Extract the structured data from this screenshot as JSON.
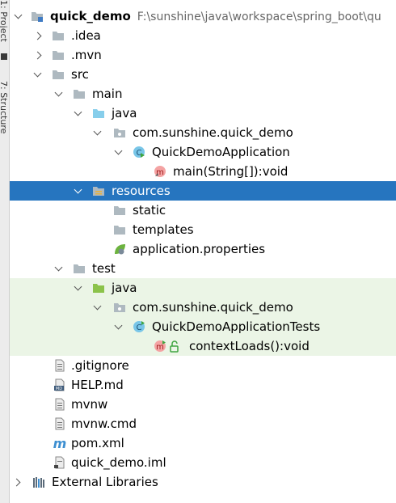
{
  "side_panel": {
    "project_tab": "1: Project",
    "structure_tab": "7: Structure"
  },
  "tree": {
    "root": {
      "name": "quick_demo",
      "path": "F:\\sunshine\\java\\workspace\\spring_boot\\qu"
    },
    "idea": ".idea",
    "mvn": ".mvn",
    "src": "src",
    "main": "main",
    "main_java": "java",
    "main_pkg": "com.sunshine.quick_demo",
    "app_class": "QuickDemoApplication",
    "main_method": "main(String[]):void",
    "resources": "resources",
    "static": "static",
    "templates": "templates",
    "app_props": "application.properties",
    "test": "test",
    "test_java": "java",
    "test_pkg": "com.sunshine.quick_demo",
    "test_class": "QuickDemoApplicationTests",
    "test_method": "contextLoads():void",
    "gitignore": ".gitignore",
    "help": "HELP.md",
    "mvnw": "mvnw",
    "mvnw_cmd": "mvnw.cmd",
    "pom": "pom.xml",
    "iml": "quick_demo.iml",
    "ext_libs": "External Libraries"
  },
  "icons": {
    "module": "module-folder-icon",
    "folder": "folder-icon",
    "source_root": "source-root-icon",
    "test_root": "test-root-icon",
    "package": "package-icon",
    "class": "spring-boot-class-icon",
    "method": "method-icon",
    "resources": "resources-root-icon",
    "properties": "spring-properties-icon",
    "file": "text-file-icon",
    "markdown": "markdown-file-icon",
    "maven": "maven-icon",
    "libraries": "libraries-icon"
  },
  "colors": {
    "selection": "#2675bf",
    "test_bg": "#ebf5e6",
    "folder": "#aeb9c0",
    "source": "#87ceeb",
    "test_folder": "#8bc34a"
  }
}
